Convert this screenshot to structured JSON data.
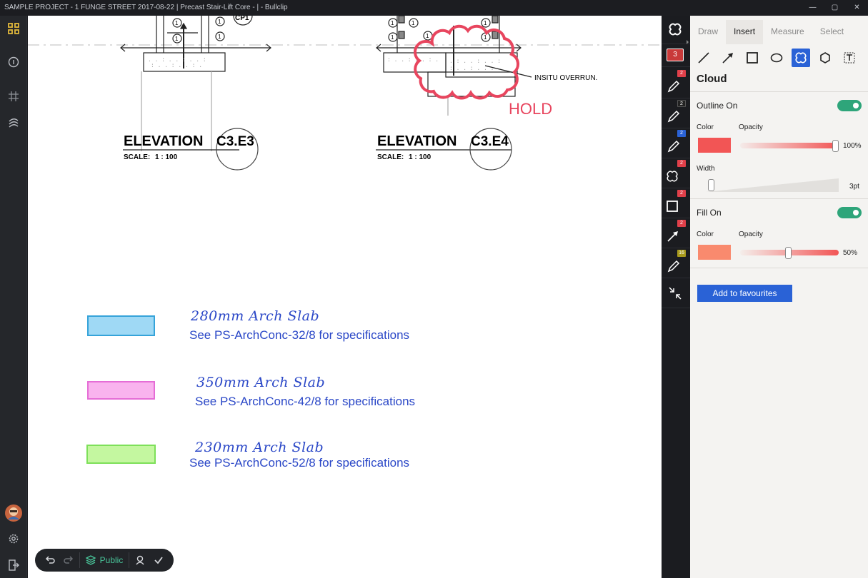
{
  "window": {
    "title": "SAMPLE PROJECT - 1 FUNGE STREET 2017-08-22 | Precast Stair-Lift Core -  | - Bullclip",
    "controls": [
      "—",
      "▢",
      "✕"
    ]
  },
  "drawing": {
    "elevation_left": {
      "title": "ELEVATION",
      "ref": "C3.E3",
      "scale_label": "SCALE:",
      "scale_value": "1 : 100"
    },
    "elevation_right": {
      "title": "ELEVATION",
      "ref": "C3.E4",
      "scale_label": "SCALE:",
      "scale_value": "1 : 100"
    },
    "callout_note": "INSITU OVERRUN.",
    "hold_text": "HOLD",
    "top_marker": "CP1",
    "circle_label": "1"
  },
  "legend": [
    {
      "title": "280mm Arch Slab",
      "spec": "See PS-ArchConc-32/8 for specifications",
      "fill": "#9fd9f5",
      "stroke": "#35a3d9"
    },
    {
      "title": "350mm Arch Slab",
      "spec": "See PS-ArchConc-42/8 for specifications",
      "fill": "#f9b3ee",
      "stroke": "#e56dd6"
    },
    {
      "title": "230mm Arch Slab",
      "spec": "See PS-ArchConc-52/8 for specifications",
      "fill": "#c4f7a0",
      "stroke": "#7ee05a"
    }
  ],
  "bottombar": {
    "visibility_label": "Public"
  },
  "toolcol": {
    "active_count": "3",
    "badges": [
      {
        "icon": "pen-icon",
        "count": "2",
        "color": "#e0404a"
      },
      {
        "icon": "pen-icon",
        "count": "2",
        "color": "#222222"
      },
      {
        "icon": "pen-icon",
        "count": "2",
        "color": "#2a62d6"
      },
      {
        "icon": "cloud-icon",
        "count": "2",
        "color": "#e0404a"
      },
      {
        "icon": "rectangle-icon",
        "count": "2",
        "color": "#e0404a"
      },
      {
        "icon": "arrow-icon",
        "count": "2",
        "color": "#e0404a"
      },
      {
        "icon": "pen-icon",
        "count": "16",
        "color": "#a89a1c"
      }
    ]
  },
  "panel": {
    "tabs": [
      "Draw",
      "Insert",
      "Measure",
      "Select"
    ],
    "active_tab": "Insert",
    "shapes": [
      "line-icon",
      "arrow-icon",
      "rectangle-icon",
      "ellipse-icon",
      "cloud-icon",
      "polygon-icon",
      "text-icon"
    ],
    "tool_title": "Cloud",
    "outline": {
      "label": "Outline On",
      "color_label": "Color",
      "opacity_label": "Opacity",
      "color": "#f25555",
      "opacity": "100%",
      "opacity_value": 1.0
    },
    "width": {
      "label": "Width",
      "value": "3pt",
      "level": 0.0
    },
    "fill": {
      "label": "Fill On",
      "color_label": "Color",
      "opacity_label": "Opacity",
      "color": "#f98a6e",
      "opacity": "50%",
      "opacity_value": 0.5
    },
    "favourite_button": "Add to favourites"
  },
  "colors": {
    "accent": "#2a62d6",
    "toggle_on": "#2ea57a",
    "markup_red": "#e8455e"
  }
}
